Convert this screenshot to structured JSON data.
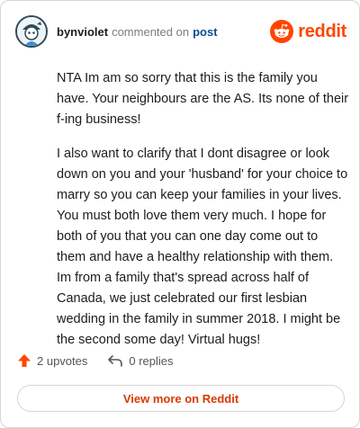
{
  "header": {
    "author": "bynviolet",
    "action": "commented on",
    "post_link": "post",
    "brand": "reddit"
  },
  "comment": {
    "paragraphs": [
      "NTA Im am so sorry that this is the family you have. Your neighbours are the AS. Its none of their f-ing business!",
      "I also want to clarify that I dont disagree or look down on you and your 'husband' for your choice to marry so you can keep your families in your lives. You must both love them very much. I hope for both of you that you can one day come out to them and have a healthy relationship with them. Im from a family that's spread across half of Canada, we just celebrated our first lesbian wedding in the family in summer 2018. I might be the second some day! Virtual hugs!"
    ]
  },
  "actions": {
    "upvotes": "2 upvotes",
    "replies": "0 replies"
  },
  "footer": {
    "view_more": "View more on Reddit"
  },
  "colors": {
    "brand": "#ff4500",
    "upvote": "#ff4500",
    "link": "#0a4d8c",
    "view_more_text": "#d93900"
  }
}
